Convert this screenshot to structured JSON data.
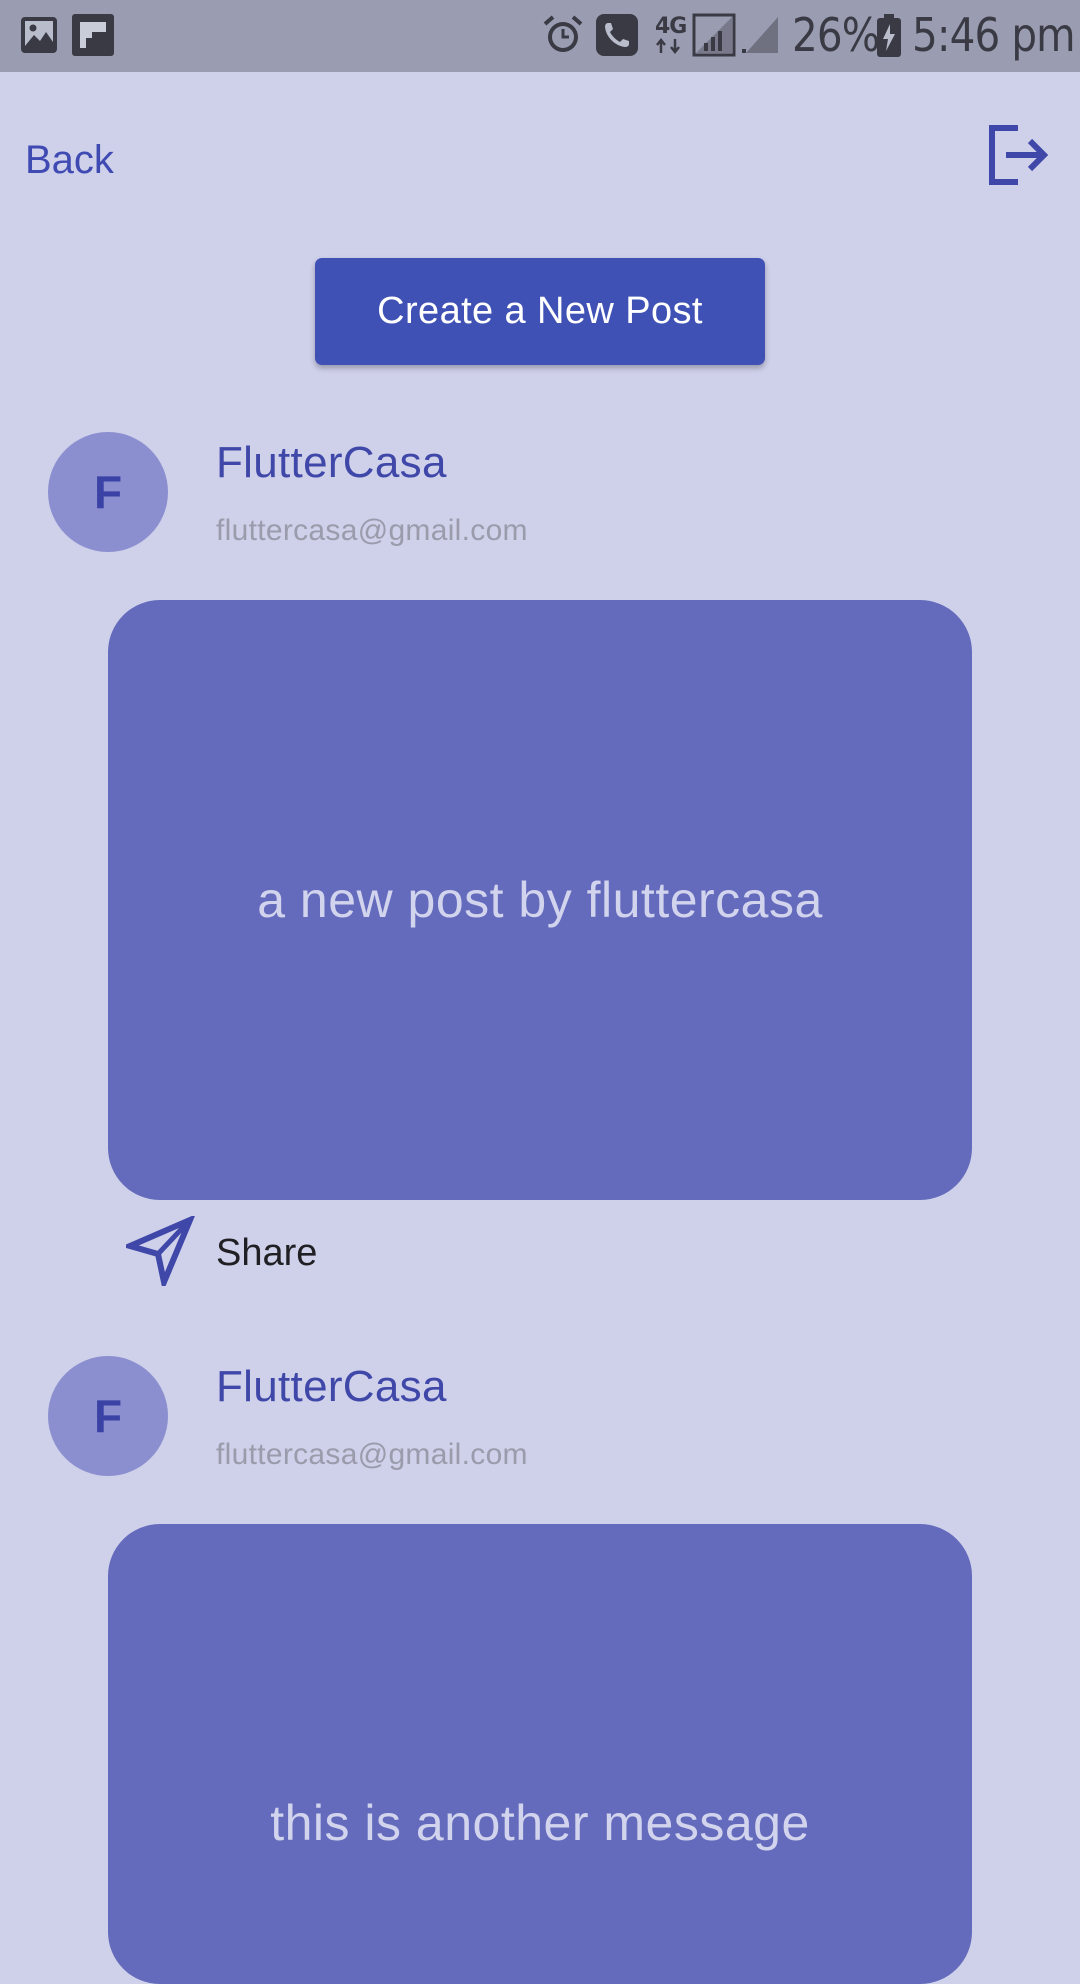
{
  "status_bar": {
    "battery": "26%",
    "time": "5:46 pm",
    "network": "4G",
    "icons": [
      "gallery-icon",
      "flipboard-icon",
      "alarm-icon",
      "call-icon",
      "network-4g-icon",
      "signal-icon",
      "signal-secondary-icon",
      "battery-icon"
    ]
  },
  "app_bar": {
    "back_label": "Back",
    "logout_icon": "logout-icon"
  },
  "create_button": {
    "label": "Create a New Post"
  },
  "posts": [
    {
      "avatar_letter": "F",
      "name": "FlutterCasa",
      "email": "fluttercasa@gmail.com",
      "message": "a new post by fluttercasa",
      "share_label": "Share",
      "share_icon": "send-icon"
    },
    {
      "avatar_letter": "F",
      "name": "FlutterCasa",
      "email": "fluttercasa@gmail.com",
      "message": "this is another message"
    }
  ],
  "colors": {
    "background": "#cfd0ea",
    "status_bar": "#9a9db2",
    "primary": "#3f51b5",
    "card": "#646bbc",
    "avatar": "#8b8fd0",
    "accent_text": "#3f48a8"
  }
}
